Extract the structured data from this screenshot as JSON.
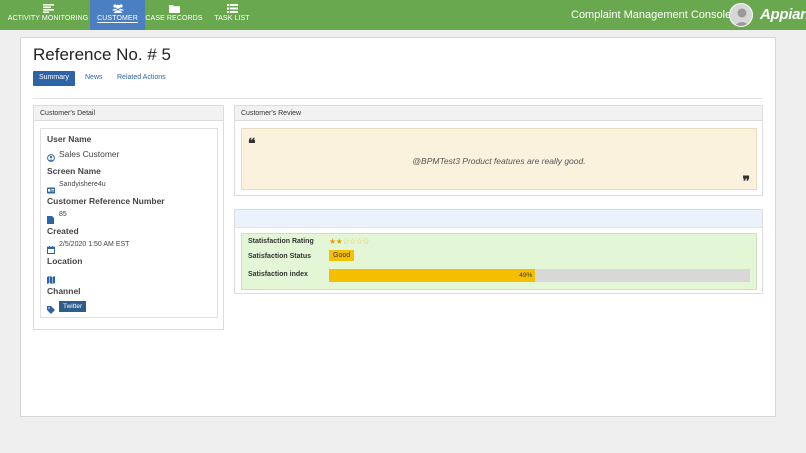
{
  "nav": {
    "items": [
      {
        "label": "ACTIVITY MONITORING",
        "icon": "list-icon"
      },
      {
        "label": "CUSTOMER",
        "icon": "users-icon"
      },
      {
        "label": "CASE RECORDS",
        "icon": "folder-icon"
      },
      {
        "label": "TASK LIST",
        "icon": "task-list-icon"
      }
    ],
    "active": "CUSTOMER",
    "console_title": "Complaint Management Console",
    "brand": "Appian",
    "colors": {
      "bar": "#6aa84f",
      "active": "#4a7fc1"
    }
  },
  "page": {
    "title": "Reference No. # 5",
    "tabs": [
      "Summary",
      "News",
      "Related Actions"
    ],
    "active_tab": "Summary"
  },
  "detail": {
    "header": "Customer's Detail",
    "user_name_label": "User Name",
    "user_name": "Sales Customer",
    "screen_name_label": "Screen Name",
    "screen_name": "Sandyishere4u",
    "ref_label": "Customer Reference Number",
    "ref_value": "85",
    "created_label": "Created",
    "created_value": "2/5/2020 1:50 AM EST",
    "location_label": "Location",
    "channel_label": "Channel",
    "channel_value": "Twitter"
  },
  "review": {
    "header": "Customer's Review",
    "text": "@BPMTest3 Product features are really good."
  },
  "rating": {
    "rating_label": "Statisfaction Rating",
    "stars_filled": 2,
    "stars_total": 5,
    "status_label": "Satisfaction Status",
    "status_value": "Good",
    "index_label": "Satisfaction index",
    "index_value": 49,
    "index_text": "49%"
  }
}
